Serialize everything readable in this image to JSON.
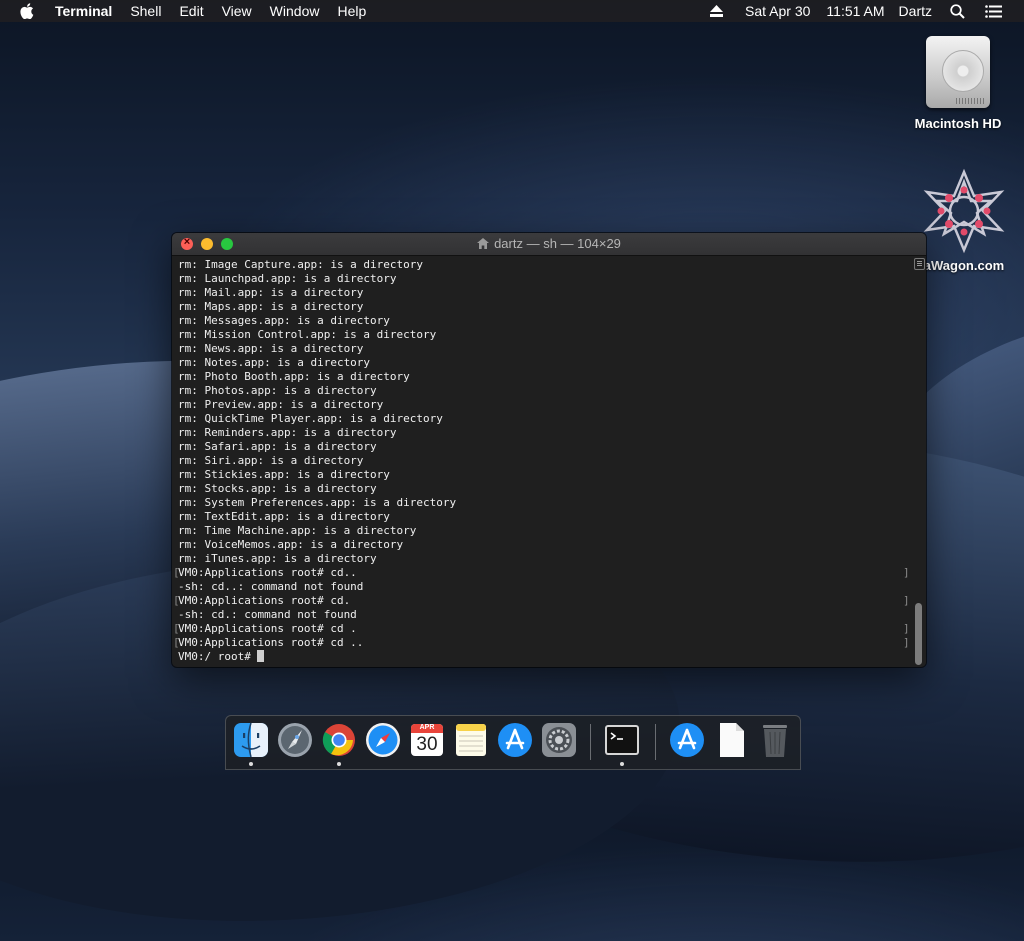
{
  "menubar": {
    "apple": "apple-menu",
    "app": "Terminal",
    "items": [
      "Shell",
      "Edit",
      "View",
      "Window",
      "Help"
    ],
    "date": "Sat Apr 30",
    "time": "11:51 AM",
    "user": "Dartz"
  },
  "desktop": {
    "icons": [
      {
        "label": "Macintosh HD",
        "icon": "hard-drive-icon"
      },
      {
        "label": "aWagon.com",
        "icon": "datawagon-logo-icon"
      }
    ]
  },
  "terminal": {
    "title": "dartz — sh — 104×29",
    "lines": [
      {
        "text": "rm: Image Capture.app: is a directory",
        "marked": false
      },
      {
        "text": "rm: Launchpad.app: is a directory",
        "marked": false
      },
      {
        "text": "rm: Mail.app: is a directory",
        "marked": false
      },
      {
        "text": "rm: Maps.app: is a directory",
        "marked": false
      },
      {
        "text": "rm: Messages.app: is a directory",
        "marked": false
      },
      {
        "text": "rm: Mission Control.app: is a directory",
        "marked": false
      },
      {
        "text": "rm: News.app: is a directory",
        "marked": false
      },
      {
        "text": "rm: Notes.app: is a directory",
        "marked": false
      },
      {
        "text": "rm: Photo Booth.app: is a directory",
        "marked": false
      },
      {
        "text": "rm: Photos.app: is a directory",
        "marked": false
      },
      {
        "text": "rm: Preview.app: is a directory",
        "marked": false
      },
      {
        "text": "rm: QuickTime Player.app: is a directory",
        "marked": false
      },
      {
        "text": "rm: Reminders.app: is a directory",
        "marked": false
      },
      {
        "text": "rm: Safari.app: is a directory",
        "marked": false
      },
      {
        "text": "rm: Siri.app: is a directory",
        "marked": false
      },
      {
        "text": "rm: Stickies.app: is a directory",
        "marked": false
      },
      {
        "text": "rm: Stocks.app: is a directory",
        "marked": false
      },
      {
        "text": "rm: System Preferences.app: is a directory",
        "marked": false
      },
      {
        "text": "rm: TextEdit.app: is a directory",
        "marked": false
      },
      {
        "text": "rm: Time Machine.app: is a directory",
        "marked": false
      },
      {
        "text": "rm: VoiceMemos.app: is a directory",
        "marked": false
      },
      {
        "text": "rm: iTunes.app: is a directory",
        "marked": false
      },
      {
        "text": "VM0:Applications root# cd..",
        "marked": true
      },
      {
        "text": "-sh: cd..: command not found",
        "marked": false
      },
      {
        "text": "VM0:Applications root# cd.",
        "marked": true
      },
      {
        "text": "-sh: cd.: command not found",
        "marked": false
      },
      {
        "text": "VM0:Applications root# cd .",
        "marked": true
      },
      {
        "text": "VM0:Applications root# cd ..",
        "marked": true
      }
    ],
    "prompt": "VM0:/ root# "
  },
  "dock": {
    "items": [
      {
        "name": "finder",
        "running": true
      },
      {
        "name": "launchpad",
        "running": false
      },
      {
        "name": "chrome",
        "running": true
      },
      {
        "name": "safari",
        "running": false
      },
      {
        "name": "calendar",
        "running": false,
        "month": "APR",
        "day": "30"
      },
      {
        "name": "notes",
        "running": false
      },
      {
        "name": "app-store",
        "running": false
      },
      {
        "name": "system-preferences",
        "running": false
      },
      {
        "name": "terminal",
        "running": true
      },
      {
        "name": "applications-folder",
        "running": false
      },
      {
        "name": "document",
        "running": false
      },
      {
        "name": "trash",
        "running": false
      }
    ]
  },
  "colors": {
    "close": "#fc5f57",
    "minimize": "#fdbc2e",
    "maximize": "#28c840",
    "terminal_bg": "#1f1f1f",
    "terminal_text": "#efefef"
  }
}
